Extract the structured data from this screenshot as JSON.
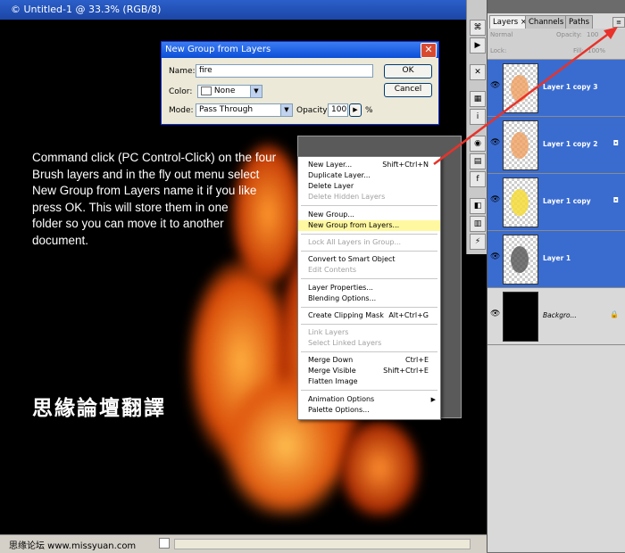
{
  "document": {
    "title": "© Untitled-1 @ 33.3% (RGB/8)",
    "watermark": "思缘论坛 www.missyuan.com"
  },
  "instruction": {
    "text": "Command click (PC Control-Click) on the four\nBrush layers and  in the fly out menu select\nNew Group from Layers name it if you like\npress OK. This will store them in one\nfolder so you can move it to another\n document.",
    "chinese": "思緣論壇翻譯"
  },
  "dialog": {
    "title": "New Group from Layers",
    "name_label": "Name:",
    "name_value": "fire",
    "color_label": "Color:",
    "color_value": "None",
    "mode_label": "Mode:",
    "mode_value": "Pass Through",
    "opacity_label": "Opacity:",
    "opacity_value": "100",
    "opacity_unit": "%",
    "ok_label": "OK",
    "cancel_label": "Cancel"
  },
  "menu": {
    "items": [
      {
        "label": "New Layer...",
        "shortcut": "Shift+Ctrl+N",
        "disabled": false
      },
      {
        "label": "Duplicate Layer...",
        "shortcut": "",
        "disabled": false
      },
      {
        "label": "Delete Layer",
        "shortcut": "",
        "disabled": false
      },
      {
        "label": "Delete Hidden Layers",
        "shortcut": "",
        "disabled": true
      },
      {
        "label": "New Group...",
        "shortcut": "",
        "disabled": false
      },
      {
        "label": "New Group from Layers...",
        "shortcut": "",
        "disabled": false,
        "highlighted": true
      },
      {
        "label": "Lock All Layers in Group...",
        "shortcut": "",
        "disabled": true
      },
      {
        "label": "Convert to Smart Object",
        "shortcut": "",
        "disabled": false
      },
      {
        "label": "Edit Contents",
        "shortcut": "",
        "disabled": true
      },
      {
        "label": "Layer Properties...",
        "shortcut": "",
        "disabled": false
      },
      {
        "label": "Blending Options...",
        "shortcut": "",
        "disabled": false
      },
      {
        "label": "Create Clipping Mask",
        "shortcut": "Alt+Ctrl+G",
        "disabled": false
      },
      {
        "label": "Link Layers",
        "shortcut": "",
        "disabled": true
      },
      {
        "label": "Select Linked Layers",
        "shortcut": "",
        "disabled": true
      },
      {
        "label": "Merge Down",
        "shortcut": "Ctrl+E",
        "disabled": false
      },
      {
        "label": "Merge Visible",
        "shortcut": "Shift+Ctrl+E",
        "disabled": false
      },
      {
        "label": "Flatten Image",
        "shortcut": "",
        "disabled": false
      },
      {
        "label": "Animation Options",
        "shortcut": "",
        "disabled": false,
        "submenu": true
      },
      {
        "label": "Palette Options...",
        "shortcut": "",
        "disabled": false
      }
    ]
  },
  "layers_panel": {
    "tabs": [
      "Layers ×",
      "Channels",
      "Paths"
    ],
    "blend_mode": "Normal",
    "opacity_label": "Opacity:",
    "opacity_value": "100",
    "lock_label": "Lock:",
    "fill_label": "Fill:",
    "fill_value": "100%",
    "layers": [
      {
        "name": "Layer 1 copy 3",
        "selected": true,
        "thumb_color": "#f0a060"
      },
      {
        "name": "Layer 1 copy 2",
        "selected": true,
        "thumb_color": "#f0a060"
      },
      {
        "name": "Layer 1 copy",
        "selected": true,
        "thumb_color": "#f5dc3a"
      },
      {
        "name": "Layer 1",
        "selected": true,
        "thumb_color": "#555555"
      },
      {
        "name": "Backgro...",
        "selected": false,
        "thumb_color": "#000000"
      }
    ]
  },
  "colors": {
    "accent": "#e8322a",
    "selection": "#3a6ccf",
    "highlight": "#fff8a0"
  }
}
